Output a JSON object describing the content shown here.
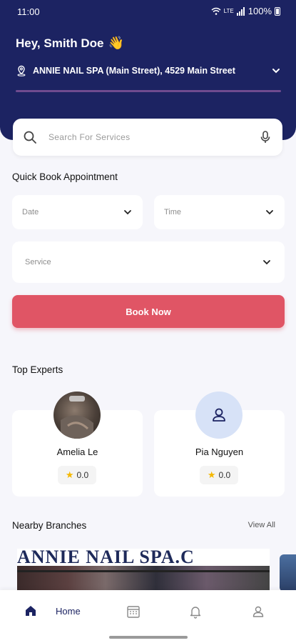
{
  "status_bar": {
    "time": "11:00",
    "indicators": "LTE",
    "battery": "100%"
  },
  "header": {
    "greeting": "Hey, Smith Doe",
    "wave_emoji": "👋",
    "location": "ANNIE NAIL SPA (Main Street), 4529 Main Street"
  },
  "search": {
    "placeholder": "Search For Services"
  },
  "quick_book": {
    "title": "Quick Book Appointment",
    "date_label": "Date",
    "time_label": "Time",
    "service_label": "Service",
    "book_button": "Book Now"
  },
  "top_experts": {
    "title": "Top Experts",
    "experts": [
      {
        "name": "Amelia Le",
        "rating": "0.0"
      },
      {
        "name": "Pia Nguyen",
        "rating": "0.0"
      }
    ]
  },
  "nearby_branches": {
    "title": "Nearby Branches",
    "view_all": "View All",
    "branch_sign": "ANNIE NAIL SPA.C"
  },
  "bottom_nav": {
    "home_label": "Home",
    "items": [
      "home-icon",
      "calendar-icon",
      "bell-icon",
      "profile-icon"
    ]
  },
  "colors": {
    "header_bg": "#1c2362",
    "accent": "#e05565",
    "divider": "#6f4b8f",
    "star": "#f5b800"
  }
}
